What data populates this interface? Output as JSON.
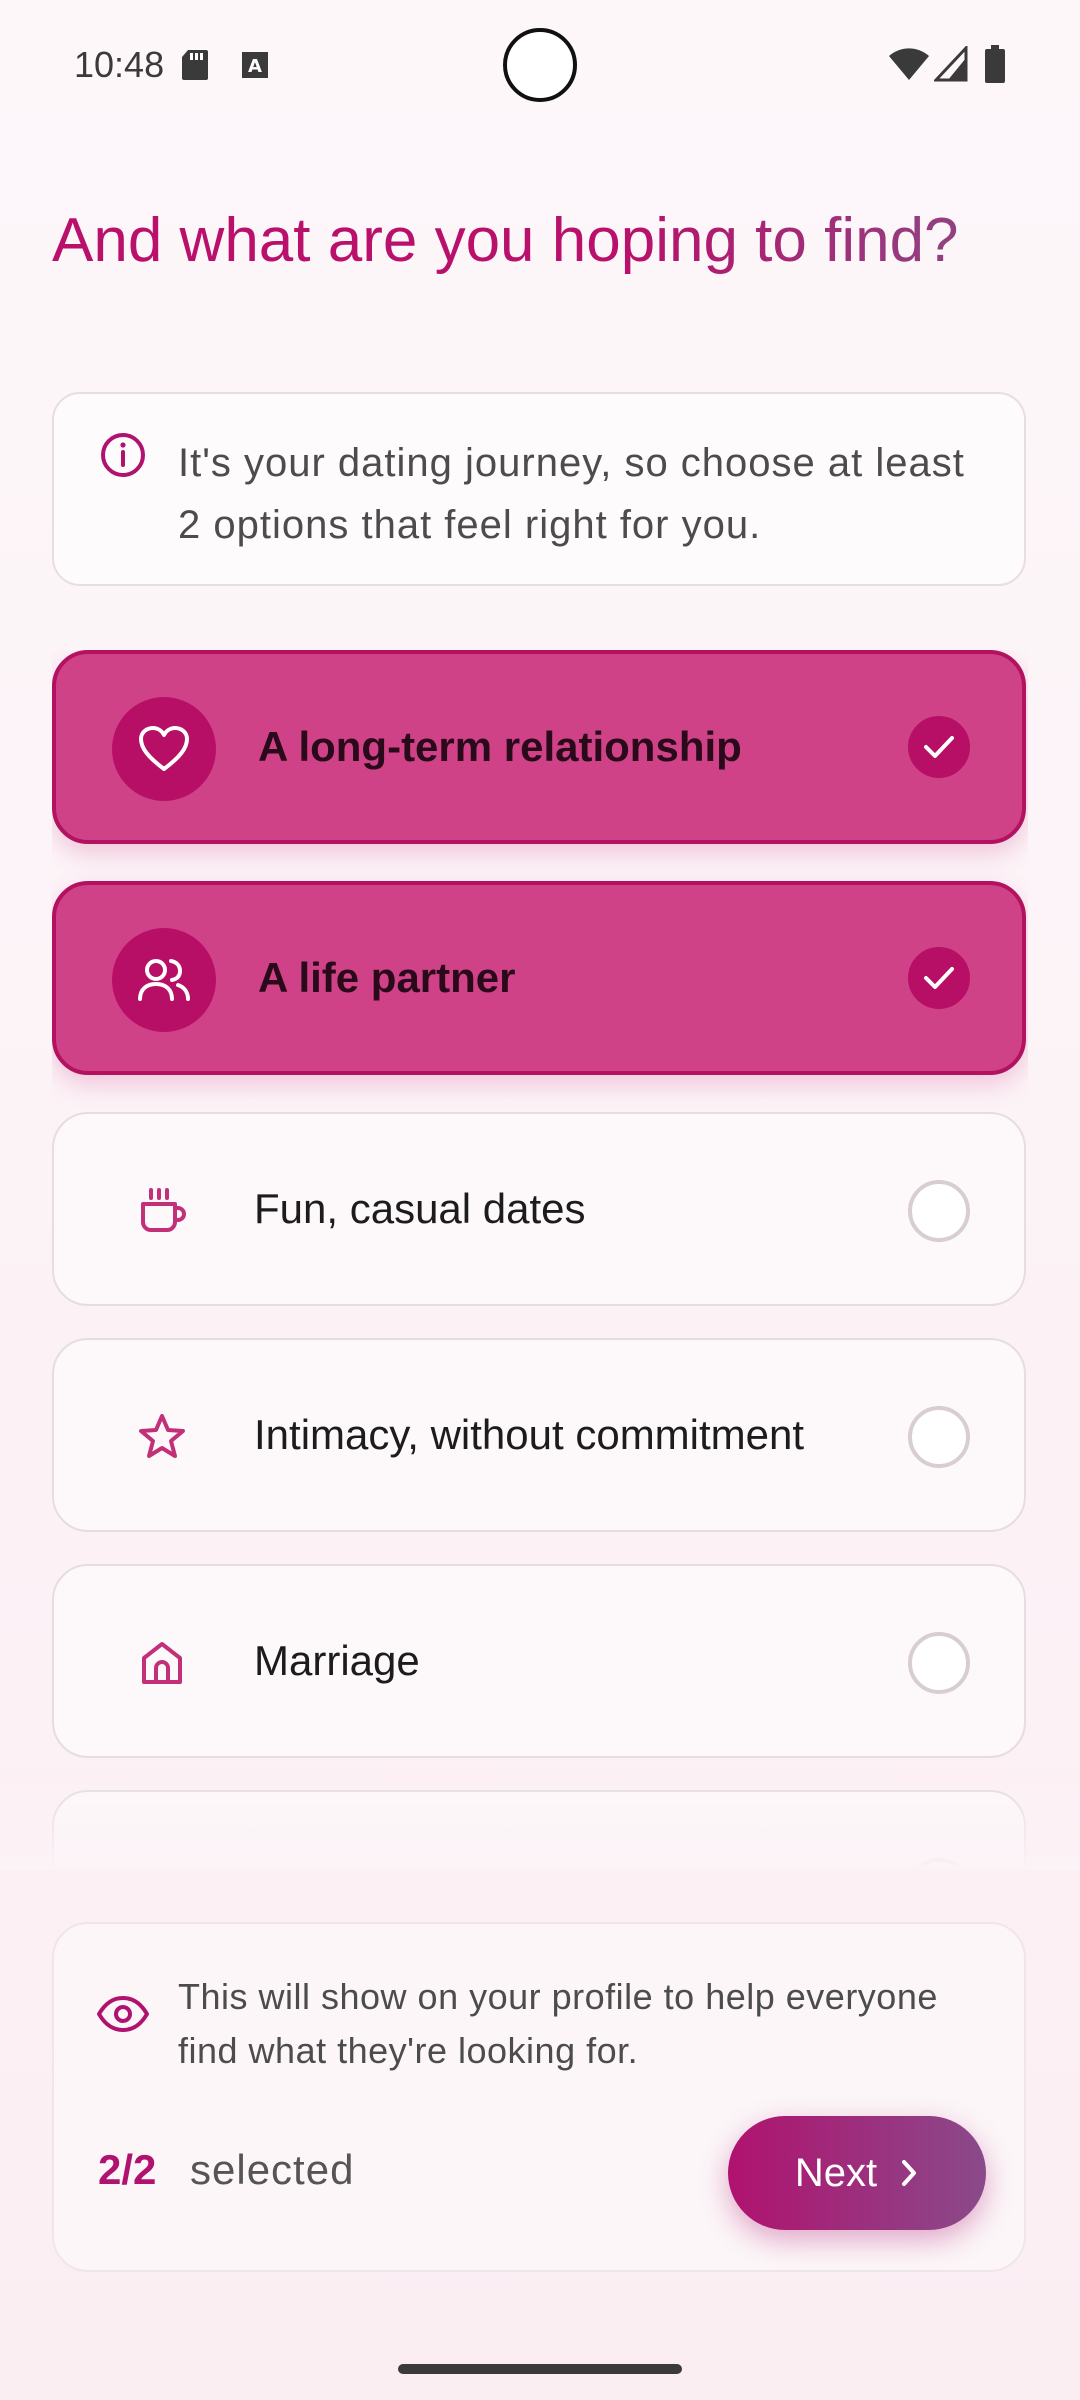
{
  "status_bar": {
    "time": "10:48",
    "icons": [
      "sd-card-icon",
      "keyboard-a-icon",
      "wifi-icon",
      "signal-icon",
      "battery-icon"
    ]
  },
  "header": {
    "title": "And what are you hoping to find?"
  },
  "info": {
    "icon": "info-icon",
    "text": "It's your dating journey, so choose at least 2 options that feel right for you."
  },
  "options": [
    {
      "label": "A long-term relationship",
      "icon": "heart-icon",
      "selected": true
    },
    {
      "label": "A life partner",
      "icon": "people-icon",
      "selected": true
    },
    {
      "label": "Fun, casual dates",
      "icon": "coffee-cup-icon",
      "selected": false
    },
    {
      "label": "Intimacy, without commitment",
      "icon": "star-icon",
      "selected": false
    },
    {
      "label": "Marriage",
      "icon": "house-icon",
      "selected": false
    }
  ],
  "footer": {
    "icon": "eye-icon",
    "note": "This will show on your profile to help everyone find what they're looking for.",
    "count": "2/2",
    "count_label": "selected",
    "next_label": "Next"
  },
  "colors": {
    "accent": "#b0126f",
    "selected_fill": "#d04288",
    "selected_border": "#b2125f"
  }
}
